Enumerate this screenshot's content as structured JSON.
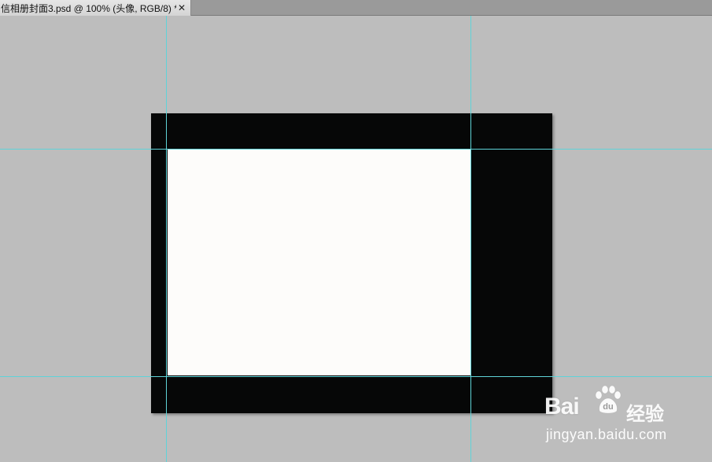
{
  "document_tab": {
    "title": "信相册封面3.psd @ 100% (头像, RGB/8) *",
    "close_symbol": "✕",
    "close_icon": "close-icon"
  },
  "canvas": {
    "frame_color": "#060707",
    "photo_area_color": "#fdfcfa",
    "workspace_color": "#bdbdbd",
    "guide_color": "#5fd3d8"
  },
  "watermark": {
    "brand": "Bai",
    "brand_suffix": "经验",
    "url": "jingyan.baidu.com",
    "icon": "baidu-paw-icon"
  }
}
